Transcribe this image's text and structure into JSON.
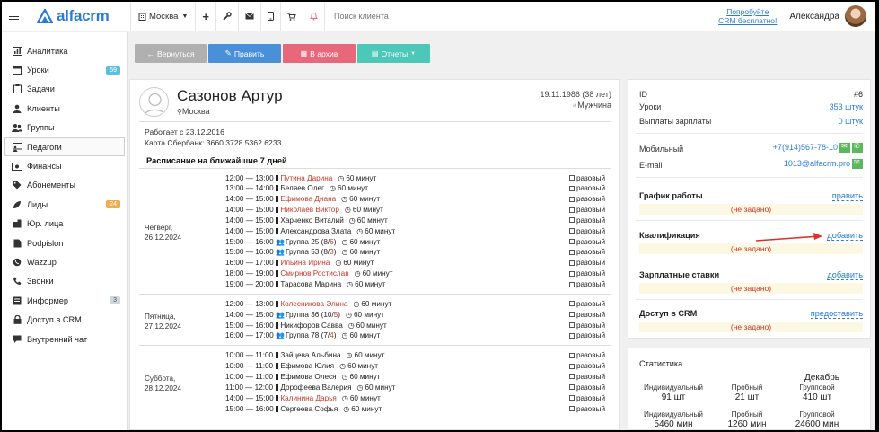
{
  "header": {
    "logo_text": "alfacrm",
    "city": "Москва",
    "search_placeholder": "Поиск клиента",
    "promo_line1": "Попробуйте",
    "promo_line2": "CRM бесплатно!",
    "user_name": "Александра"
  },
  "sidebar": {
    "items": [
      {
        "label": "Аналитика",
        "icon": "analytics-icon"
      },
      {
        "label": "Уроки",
        "icon": "lessons-icon",
        "badge": "59",
        "badge_color": "#5bc0de"
      },
      {
        "label": "Задачи",
        "icon": "tasks-icon"
      },
      {
        "label": "Клиенты",
        "icon": "client-icon"
      },
      {
        "label": "Группы",
        "icon": "groups-icon"
      },
      {
        "label": "Педагоги",
        "icon": "teacher-icon",
        "active": true
      },
      {
        "label": "Финансы",
        "icon": "finance-icon"
      },
      {
        "label": "Абонементы",
        "icon": "tag-icon"
      },
      {
        "label": "Лиды",
        "icon": "leads-icon",
        "badge": "24",
        "badge_color": "#f0ad4e"
      },
      {
        "label": "Юр. лица",
        "icon": "building-icon"
      },
      {
        "label": "Podpislon",
        "icon": "document-icon"
      },
      {
        "label": "Wazzup",
        "icon": "whatsapp-icon"
      },
      {
        "label": "Звонки",
        "icon": "phone-icon"
      },
      {
        "label": "Информер",
        "icon": "informer-icon",
        "badge": "3",
        "badge_color": "#cfd8dc"
      },
      {
        "label": "Доступ в CRM",
        "icon": "lock-icon"
      },
      {
        "label": "Внутренний чат",
        "icon": "chat-icon"
      }
    ]
  },
  "toolbar": {
    "back_label": "Вернуться",
    "edit_label": "Править",
    "archive_label": "В архив",
    "reports_label": "Отчеты",
    "colors": {
      "back": "#b0b0b0",
      "edit": "#4a90d9",
      "archive": "#e8677a",
      "reports": "#4dc7b8"
    }
  },
  "profile": {
    "name": "Сазонов Артур",
    "city": "Москва",
    "birth_date": "19.11.1986 (38 лет)",
    "gender": "Мужчина",
    "works_since": "Работает с 23.12.2016",
    "card": "Карта Сбербанк: 3660 3728 5362 6233"
  },
  "schedule": {
    "title": "Расписание на ближайшие 7 дней",
    "duration": "60 минут",
    "kind": "разовый",
    "days": [
      {
        "label": "Четверг,\n26.12.2024",
        "lessons": [
          {
            "time": "12:00 — 13:00",
            "who": "Путина Дарина",
            "red": true
          },
          {
            "time": "13:00 — 14:00",
            "who": "Беляев Олег"
          },
          {
            "time": "14:00 — 15:00",
            "who": "Ефимова Диана",
            "red": true
          },
          {
            "time": "14:00 — 15:00",
            "who": "Николаев Виктор",
            "red": true
          },
          {
            "time": "14:00 — 15:00",
            "who": "Харченко Виталий"
          },
          {
            "time": "14:00 — 15:00",
            "who": "Александрова Злата"
          },
          {
            "time": "15:00 — 16:00",
            "who": "Группа 25",
            "group": true,
            "a": "8",
            "b": "6"
          },
          {
            "time": "15:00 — 16:00",
            "who": "Группа 53",
            "group": true,
            "a": "8",
            "b": "3"
          },
          {
            "time": "16:00 — 17:00",
            "who": "Ильина Ирина",
            "red": true
          },
          {
            "time": "18:00 — 19:00",
            "who": "Смирнов Ростислав",
            "red": true
          },
          {
            "time": "19:00 — 20:00",
            "who": "Тарасова Марина"
          }
        ]
      },
      {
        "label": "Пятница,\n27.12.2024",
        "lessons": [
          {
            "time": "12:00 — 13:00",
            "who": "Колесникова Элина",
            "red": true
          },
          {
            "time": "14:00 — 15:00",
            "who": "Группа 36",
            "group": true,
            "a": "10",
            "b": "5"
          },
          {
            "time": "15:00 — 16:00",
            "who": "Никифоров Савва"
          },
          {
            "time": "16:00 — 17:00",
            "who": "Группа 78",
            "group": true,
            "a": "7",
            "b": "4"
          }
        ]
      },
      {
        "label": "Суббота,\n28.12.2024",
        "lessons": [
          {
            "time": "10:00 — 11:00",
            "who": "Зайцева Альбина"
          },
          {
            "time": "10:00 — 11:00",
            "who": "Ефимова Юлия"
          },
          {
            "time": "10:00 — 11:00",
            "who": "Ефимова Олеся"
          },
          {
            "time": "11:00 — 12:00",
            "who": "Дорофеева Валерия"
          },
          {
            "time": "14:00 — 15:00",
            "who": "Калинина Дарья",
            "red": true
          },
          {
            "time": "15:00 — 16:00",
            "who": "Сергеева Софья"
          }
        ]
      }
    ]
  },
  "details": {
    "id_label": "ID",
    "id_value": "#6",
    "lessons_label": "Уроки",
    "lessons_value": "353 штук",
    "payouts_label": "Выплаты зарплаты",
    "payouts_value": "0 штук",
    "mobile_label": "Мобильный",
    "mobile_value": "+7(914)567-78-10",
    "email_label": "E-mail",
    "email_value": "1013@alfacrm.pro",
    "sections": [
      {
        "title": "График работы",
        "link": "править",
        "empty": "(не задано)"
      },
      {
        "title": "Квалификация",
        "link": "добавить",
        "empty": "(не задано)"
      },
      {
        "title": "Зарплатные ставки",
        "link": "добавить",
        "empty": "(не задано)"
      },
      {
        "title": "Доступ в CRM",
        "link": "предоставить",
        "empty": "(не задано)"
      }
    ]
  },
  "stats": {
    "title": "Статистика",
    "month": "Декабрь",
    "cells": [
      {
        "label": "Индивидуальный",
        "value": "91 шт"
      },
      {
        "label": "Пробный",
        "value": "21 шт"
      },
      {
        "label": "Групповой",
        "value": "410 шт"
      },
      {
        "label": "Индивидуальный",
        "value": "5460 мин"
      },
      {
        "label": "Пробный",
        "value": "1260 мин"
      },
      {
        "label": "Групповой",
        "value": "24600 мин"
      }
    ]
  }
}
